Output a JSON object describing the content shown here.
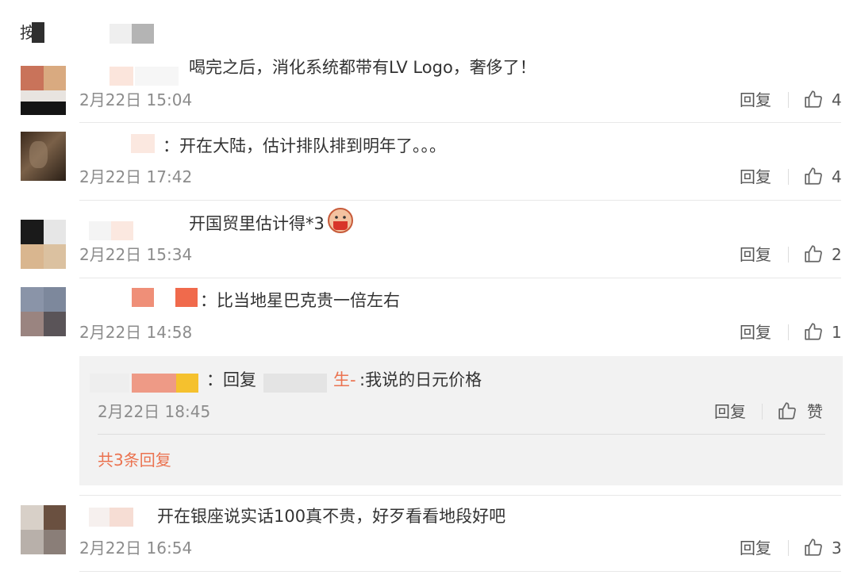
{
  "colors": {
    "accent": "#eb7350",
    "meta": "#8c8c8c",
    "text": "#333333",
    "reply_bg": "#f2f2f2"
  },
  "header": {
    "partial_text": "按"
  },
  "comments": [
    {
      "text": "喝完之后，消化系统都带有LV Logo，奢侈了！",
      "time": "2月22日 15:04",
      "reply": "回复",
      "likes": "4"
    },
    {
      "text": "：开在大陆，估计排队排到明年了。。。",
      "time": "2月22日 17:42",
      "reply": "回复",
      "likes": "4"
    },
    {
      "text": "开国贸里估计得*3",
      "time": "2月22日 15:34",
      "reply": "回复",
      "likes": "2"
    },
    {
      "text": "：比当地星巴克贵一倍左右",
      "time": "2月22日 14:58",
      "reply": "回复",
      "likes": "1",
      "sub_reply": {
        "prefix": "：回复",
        "mention_suffix": "生-",
        "text": ":我说的日元价格",
        "time": "2月22日 18:45",
        "reply": "回复",
        "like_label": "赞",
        "more": "共3条回复"
      }
    },
    {
      "text": "开在银座说实话100真不贵，好歹看看地段好吧",
      "time": "2月22日 16:54",
      "reply": "回复",
      "likes": "3"
    }
  ],
  "icons": {
    "like": "thumbs-up-icon",
    "emoji": "mask-emoji-icon"
  }
}
